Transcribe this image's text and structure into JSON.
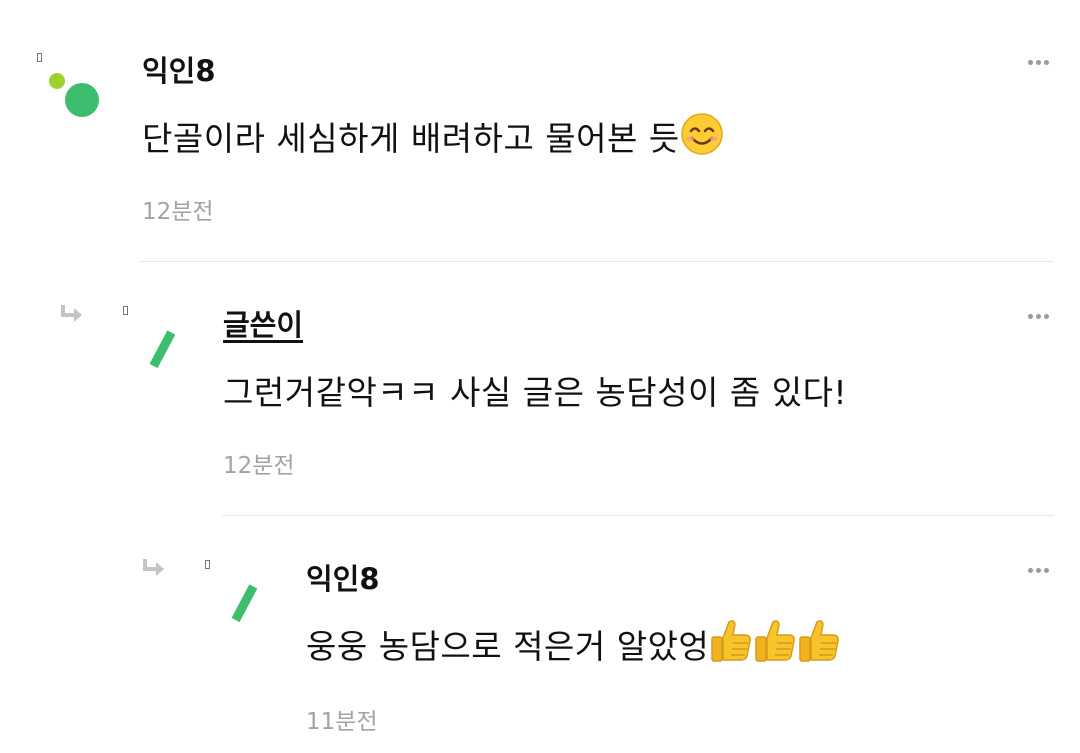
{
  "comments": [
    {
      "author": "익인8",
      "text": "단골이라 세심하게 배려하고 물어본 듯",
      "emoji": [
        "smiling-face-emoji"
      ],
      "time": "12분전",
      "is_reply": false,
      "avatar": "green-dots-avatar"
    },
    {
      "author": "글쓴이",
      "text": "그런거같악ㅋㅋ 사실 글은 농담성이 좀 있다!",
      "emoji": [],
      "time": "12분전",
      "is_reply": true,
      "avatar": "green-stroke-avatar"
    },
    {
      "author": "익인8",
      "text": "웅웅 농담으로 적은거 알았엉",
      "emoji": [
        "thumbs-up-emoji",
        "thumbs-up-emoji",
        "thumbs-up-emoji"
      ],
      "time": "11분전",
      "is_reply": true,
      "avatar": "green-stroke-avatar"
    }
  ],
  "icons": {
    "more": "more-options-icon",
    "reply": "reply-arrow-icon"
  },
  "colors": {
    "avatar_green": "#3dbd6e",
    "avatar_lime": "#9ed12e",
    "time_gray": "#a3a3a3",
    "divider": "#e6e6e6"
  }
}
